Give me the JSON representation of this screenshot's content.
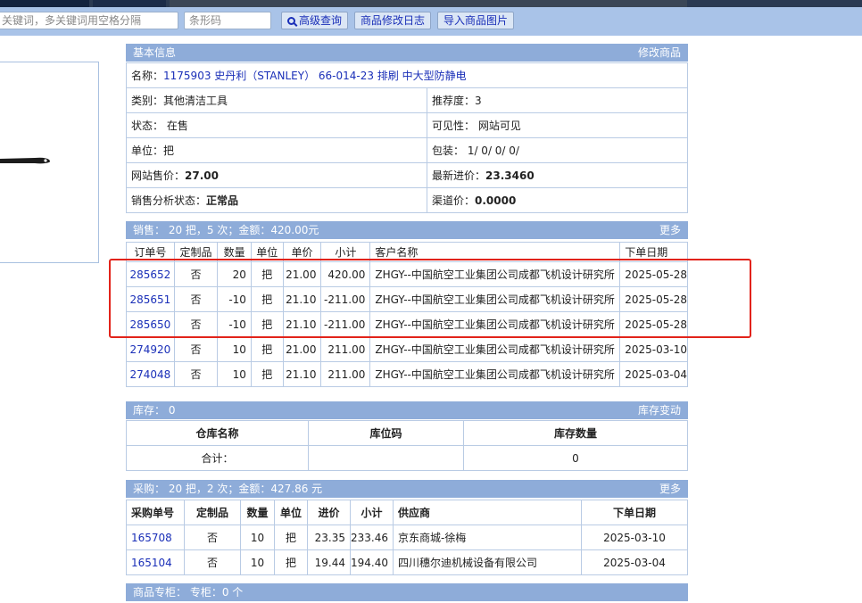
{
  "search": {
    "keyword_placeholder": "关键词，多关键词用空格分隔",
    "barcode_placeholder": "条形码",
    "advanced_label": "高级查询",
    "modlog_label": "商品修改日志",
    "import_label": "导入商品图片"
  },
  "basic": {
    "header": "基本信息",
    "edit_link": "修改商品",
    "name_label": "名称：",
    "name_value": "1175903 史丹利（STANLEY） 66-014-23 排刷 中大型防静电",
    "category": "类别：其他清洁工具",
    "recommend": "推荐度：3",
    "status": "状态： 在售",
    "visibility": "可见性： 网站可见",
    "unit": "单位：把",
    "package": "包装： 1/ 0/ 0/ 0/",
    "site_price_label": "网站售价：",
    "site_price_value": "27.00",
    "latest_cost_label": "最新进价：",
    "latest_cost_value": "23.3460",
    "sales_status_label": "销售分析状态：",
    "sales_status_value": "正常品",
    "channel_price_label": "渠道价：",
    "channel_price_value": "0.0000"
  },
  "sales": {
    "header": "销售： 20 把，5 次；金额：420.00元",
    "more": "更多",
    "columns": [
      "订单号",
      "定制品",
      "数量",
      "单位",
      "单价",
      "小计",
      "客户名称",
      "下单日期"
    ],
    "rows": [
      [
        "285652",
        "否",
        "20",
        "把",
        "21.00",
        "420.00",
        "ZHGY--中国航空工业集团公司成都飞机设计研究所",
        "2025-05-28"
      ],
      [
        "285651",
        "否",
        "-10",
        "把",
        "21.10",
        "-211.00",
        "ZHGY--中国航空工业集团公司成都飞机设计研究所",
        "2025-05-28"
      ],
      [
        "285650",
        "否",
        "-10",
        "把",
        "21.10",
        "-211.00",
        "ZHGY--中国航空工业集团公司成都飞机设计研究所",
        "2025-05-28"
      ],
      [
        "274920",
        "否",
        "10",
        "把",
        "21.00",
        "211.00",
        "ZHGY--中国航空工业集团公司成都飞机设计研究所",
        "2025-03-10"
      ],
      [
        "274048",
        "否",
        "10",
        "把",
        "21.10",
        "211.00",
        "ZHGY--中国航空工业集团公司成都飞机设计研究所",
        "2025-03-04"
      ]
    ]
  },
  "stock": {
    "header": "库存： 0",
    "link": "库存变动",
    "columns": [
      "仓库名称",
      "库位码",
      "库存数量"
    ],
    "total_label": "合计：",
    "total_value": "0"
  },
  "purchase": {
    "header": "采购： 20 把，2 次；金额：427.86 元",
    "more": "更多",
    "columns": [
      "采购单号",
      "定制品",
      "数量",
      "单位",
      "进价",
      "小计",
      "供应商",
      "下单日期"
    ],
    "rows": [
      [
        "165708",
        "否",
        "10",
        "把",
        "23.35",
        "233.46",
        "京东商城-徐梅",
        "2025-03-10"
      ],
      [
        "165104",
        "否",
        "10",
        "把",
        "19.44",
        "194.40",
        "四川穗尔迪机械设备有限公司",
        "2025-03-04"
      ]
    ]
  },
  "counter": {
    "header": "商品专柜： 专柜：0 个"
  },
  "colors": {
    "header_bg": "#8eacd9",
    "link": "#1a2fb8",
    "highlight": "#e2231a"
  }
}
